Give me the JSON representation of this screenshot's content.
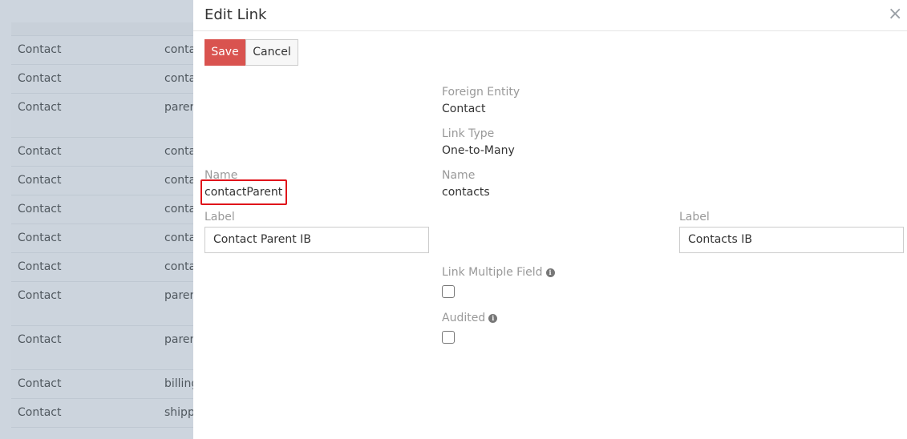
{
  "background_list": {
    "rows": [
      {
        "entity": "Contact",
        "link": "conta",
        "height": 36
      },
      {
        "entity": "Contact",
        "link": "conta",
        "height": 36
      },
      {
        "entity": "Contact",
        "link": "parer",
        "height": 55
      },
      {
        "entity": "Contact",
        "link": "conta",
        "height": 36
      },
      {
        "entity": "Contact",
        "link": "conta",
        "height": 36
      },
      {
        "entity": "Contact",
        "link": "conta",
        "height": 36
      },
      {
        "entity": "Contact",
        "link": "conta",
        "height": 36
      },
      {
        "entity": "Contact",
        "link": "conta",
        "height": 36
      },
      {
        "entity": "Contact",
        "link": "parer",
        "height": 55
      },
      {
        "entity": "Contact",
        "link": "parer",
        "height": 55
      },
      {
        "entity": "Contact",
        "link": "billing",
        "height": 36
      },
      {
        "entity": "Contact",
        "link": "shipp",
        "height": 36
      }
    ]
  },
  "modal": {
    "title": "Edit Link",
    "close_glyph": "×",
    "save_label": "Save",
    "cancel_label": "Cancel",
    "foreign_entity_label": "Foreign Entity",
    "foreign_entity_value": "Contact",
    "link_type_label": "Link Type",
    "link_type_value": "One-to-Many",
    "name_left_label": "Name",
    "name_left_value": "contactParent",
    "name_right_label": "Name",
    "name_right_value": "contacts",
    "label_left_label": "Label",
    "label_left_value": "Contact Parent IB",
    "label_right_label": "Label",
    "label_right_value": "Contacts IB",
    "link_multiple_label": "Link Multiple Field",
    "audited_label": "Audited",
    "info_glyph": "i",
    "link_multiple_checked": false,
    "audited_checked": false
  },
  "colors": {
    "save_button": "#d9534f",
    "highlight_box": "#e0131a"
  }
}
